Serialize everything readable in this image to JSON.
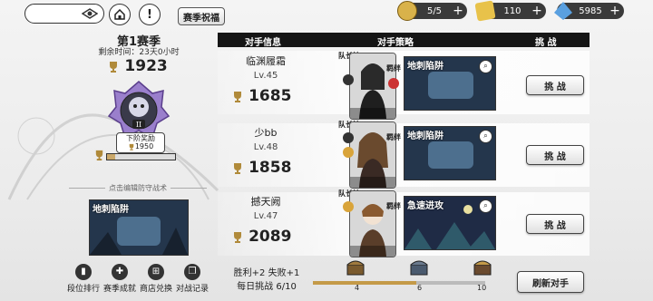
{
  "top": {
    "season_blessing": "赛季祝福",
    "resources": [
      {
        "icon": "stamina-icon",
        "value": "5/5",
        "color": "#d9b24a"
      },
      {
        "icon": "ticket-icon",
        "value": "110",
        "color": "#e8c24a"
      },
      {
        "icon": "crystal-icon",
        "value": "5985",
        "color": "#5aa0e0"
      }
    ]
  },
  "season": {
    "title": "第1赛季",
    "remaining": "剩余时间：23天0小时",
    "score": "1923",
    "rank_numeral": "II",
    "next_reward_label": "下阶奖励",
    "next_reward_score": "1950",
    "progress": 0.12,
    "edit_tip": "点击编辑防守战术",
    "defense_card": "地刺陷阱"
  },
  "header": {
    "opponent": "对手信息",
    "strategy": "对手策略",
    "challenge": "挑 战"
  },
  "opponents": [
    {
      "name": "临渊履霜",
      "level": "Lv.45",
      "score": "1685",
      "captain": "队长技",
      "bond": "羁绊",
      "strategy": "地刺陷阱",
      "challenge": "挑 战"
    },
    {
      "name": "少bb",
      "level": "Lv.48",
      "score": "1858",
      "captain": "队长技",
      "bond": "羁绊",
      "strategy": "地刺陷阱",
      "challenge": "挑 战"
    },
    {
      "name": "撼天阙",
      "level": "Lv.47",
      "score": "2089",
      "captain": "队长技",
      "bond": "羁绊",
      "strategy": "急速进攻",
      "challenge": "挑 战"
    }
  ],
  "menu": [
    "段位排行",
    "赛季成就",
    "商店兑换",
    "对战记录"
  ],
  "bottom": {
    "record": "胜利+2 失败+1",
    "daily": "每日挑战 6/10",
    "milestones": [
      "4",
      "6",
      "10"
    ],
    "progress": 0.6,
    "refresh": "刷新对手"
  },
  "colors": {
    "accent": "#c49a48",
    "dark": "#151515",
    "card_blue": "#2a4a6a"
  }
}
